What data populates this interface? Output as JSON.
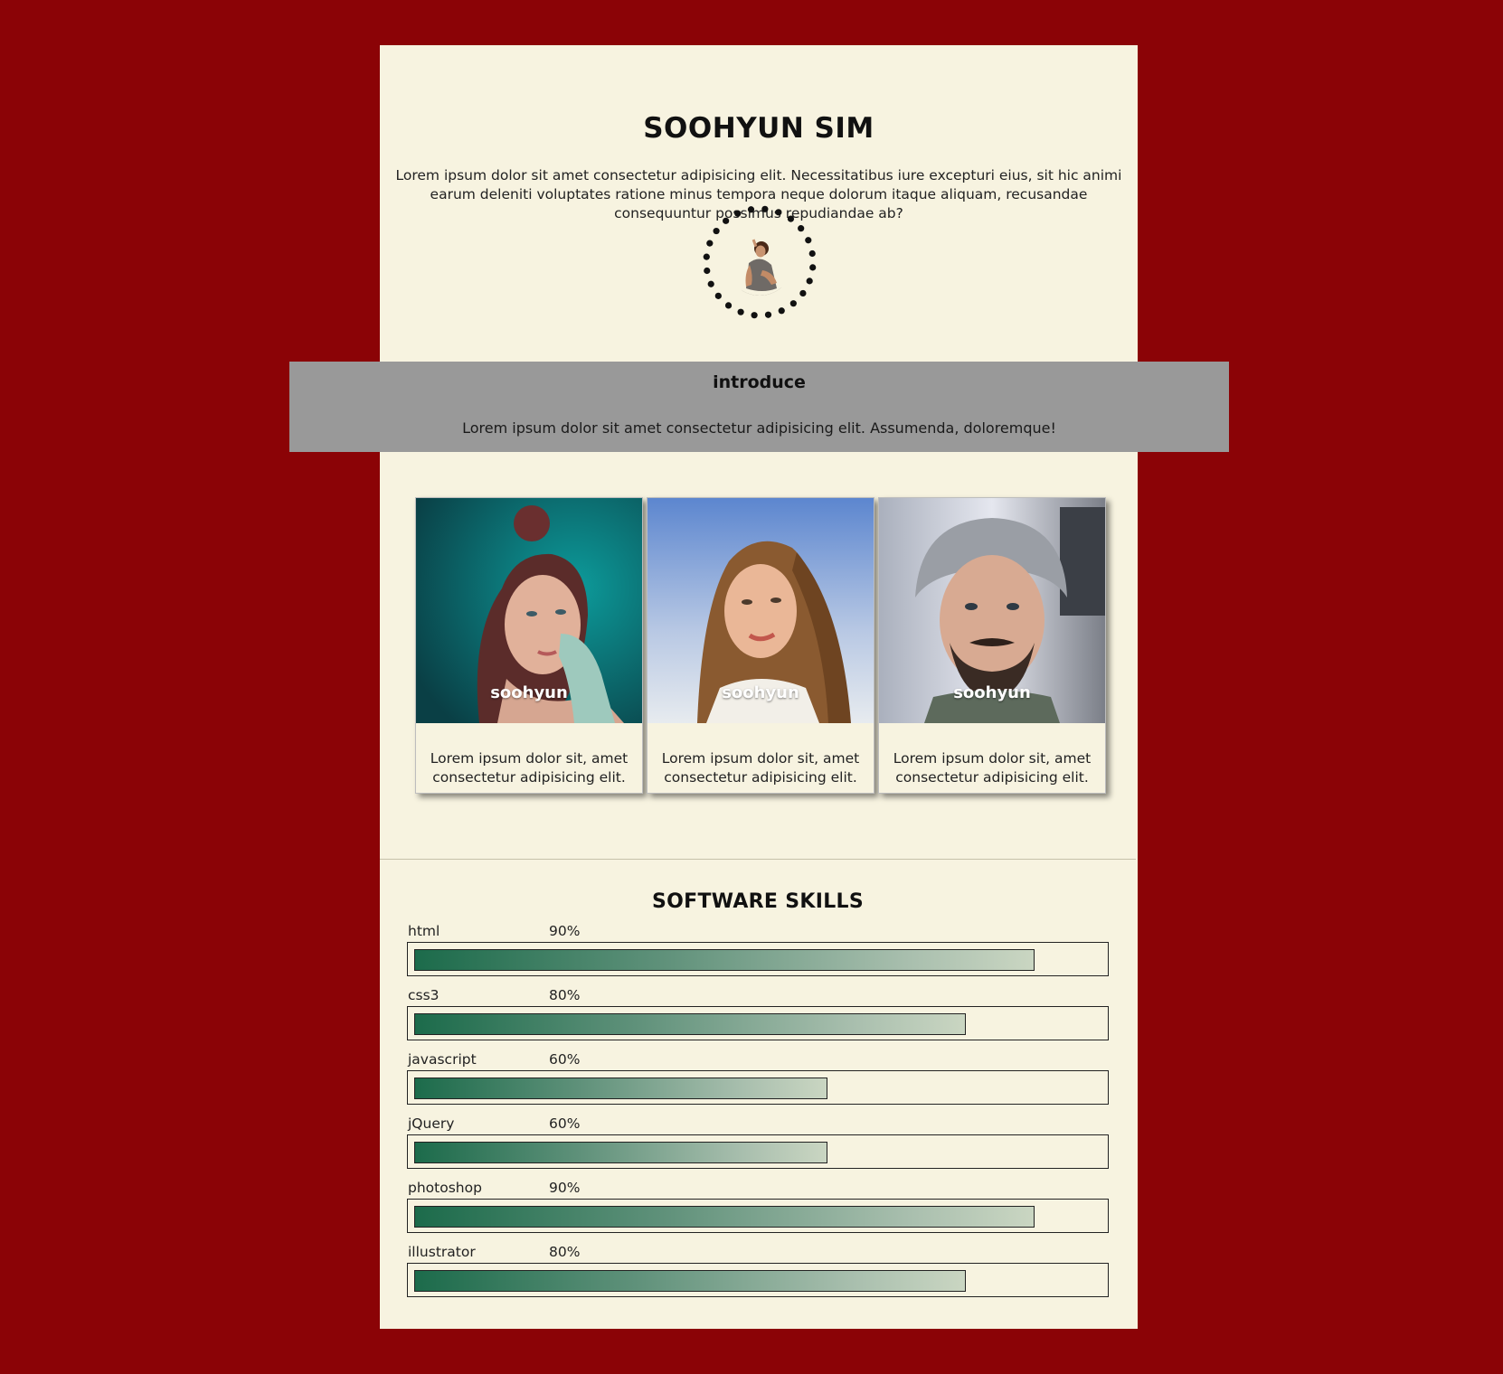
{
  "header": {
    "title": "SOOHYUN SIM",
    "description": "Lorem ipsum dolor sit amet consectetur adipisicing elit. Necessitatibus iure excepturi eius, sit hic animi earum deleniti voluptates ratione minus tempora neque dolorum itaque aliquam, recusandae consequuntur possimus repudiandae ab?"
  },
  "introduce": {
    "title": "introduce",
    "text": "Lorem ipsum dolor sit amet consectetur adipisicing elit. Assumenda, doloremque!"
  },
  "cards": [
    {
      "name": "soohyun",
      "desc": "Lorem ipsum dolor sit, amet consectetur adipisicing elit."
    },
    {
      "name": "soohyun",
      "desc": "Lorem ipsum dolor sit, amet consectetur adipisicing elit."
    },
    {
      "name": "soohyun",
      "desc": "Lorem ipsum dolor sit, amet consectetur adipisicing elit."
    }
  ],
  "skills": {
    "title": "SOFTWARE SKILLS",
    "items": [
      {
        "name": "html",
        "percent_label": "90%",
        "level": 0.9
      },
      {
        "name": "css3",
        "percent_label": "80%",
        "level": 0.8
      },
      {
        "name": "javascript",
        "percent_label": "60%",
        "level": 0.6
      },
      {
        "name": "jQuery",
        "percent_label": "60%",
        "level": 0.6
      },
      {
        "name": "photoshop",
        "percent_label": "90%",
        "level": 0.9
      },
      {
        "name": "illustrator",
        "percent_label": "80%",
        "level": 0.8
      }
    ]
  },
  "colors": {
    "background": "#8b0306",
    "page": "#f7f3e0",
    "introduce_band": "#999999",
    "bar_start": "#1c6b4b",
    "bar_end": "#cad6c2"
  }
}
